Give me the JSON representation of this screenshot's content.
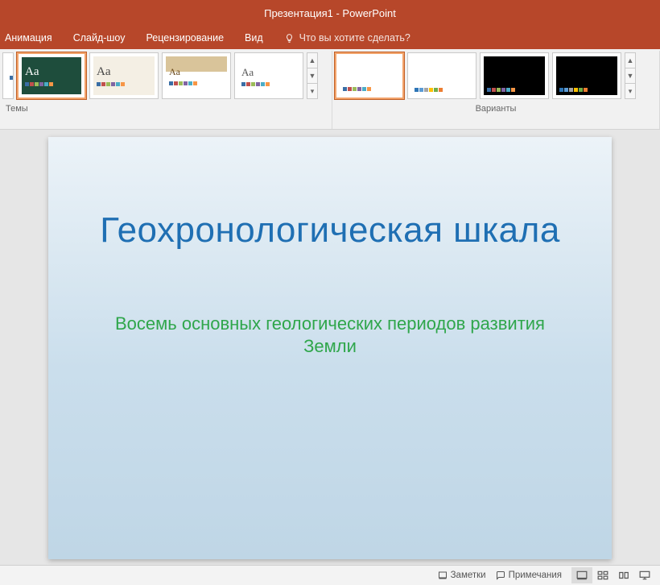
{
  "window_title": "Презентация1 - PowerPoint",
  "tabs": {
    "animation": "Анимация",
    "slideshow": "Слайд-шоу",
    "review": "Рецензирование",
    "view": "Вид",
    "tellme": "Что вы хотите сделать?"
  },
  "ribbon": {
    "themes_label": "Темы",
    "variants_label": "Варианты"
  },
  "slide": {
    "title": "Геохронологическая шкала",
    "subtitle": "Восемь основных геологических периодов развития Земли"
  },
  "status": {
    "notes": "Заметки",
    "comments": "Примечания"
  },
  "palette": {
    "strip": [
      "#3a6ea5",
      "#c0504d",
      "#9bbb59",
      "#8064a2",
      "#4bacc6",
      "#f79646"
    ]
  }
}
